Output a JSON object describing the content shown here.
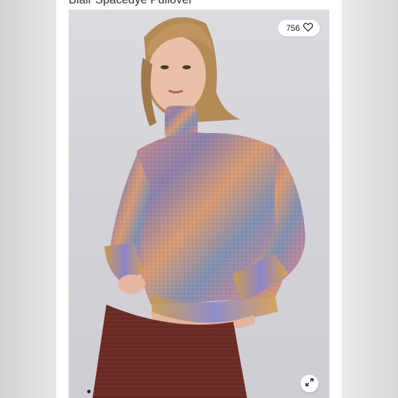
{
  "listing": {
    "title": "Blair Spacedye Pullover",
    "like_count": "756"
  },
  "icons": {
    "like": "heart-icon",
    "expand": "expand-arrows-icon"
  },
  "carousel": {
    "indicator_count": 1
  },
  "colors": {
    "background": "#ffffff",
    "photo_backdrop": "#d6d5da",
    "pants": "#6a2a22",
    "sweater_base": "#b88a90"
  }
}
